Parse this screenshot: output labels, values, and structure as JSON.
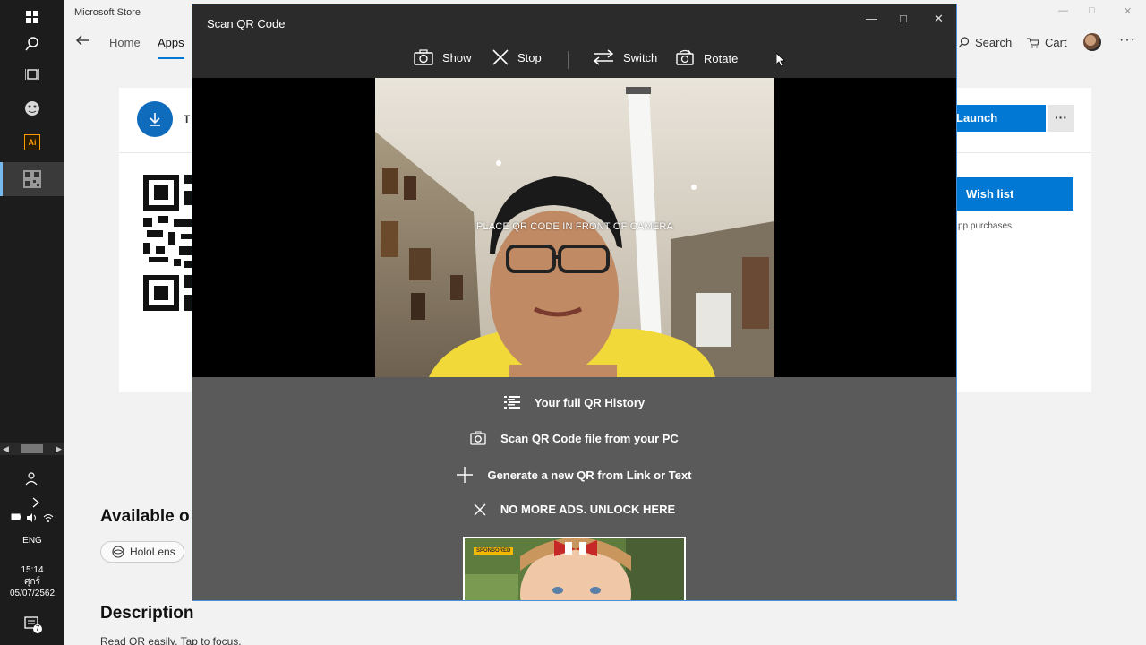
{
  "taskbar": {
    "icons": [
      "windows-start-icon",
      "search-icon",
      "task-view-icon",
      "cortana-icon",
      "illustrator-icon",
      "qr-scanner-icon"
    ],
    "illustrator_label": "Ai",
    "language": "ENG",
    "time": "15:14",
    "day": "ศุกร์",
    "date": "05/07/2562",
    "notification_count": "7"
  },
  "store": {
    "title": "Microsoft Store",
    "nav": {
      "home": "Home",
      "apps": "Apps"
    },
    "search_label": "Search",
    "cart_label": "Cart",
    "app_title_fragment": "T",
    "launch_label": "Launch",
    "more_label": "···",
    "wishlist_label": "Wish list",
    "purchases_fragment": "pp purchases",
    "available_heading": "Available o",
    "device_chip": "HoloLens",
    "description_heading": "Description",
    "description_text": "Read QR easily. Tap to focus."
  },
  "qr_window": {
    "title": "Scan QR Code",
    "toolbar": {
      "show": "Show",
      "stop": "Stop",
      "switch": "Switch",
      "rotate": "Rotate"
    },
    "camera_prompt": "PLACE QR CODE IN FRONT OF CAMERA",
    "menu": {
      "history": "Your full QR History",
      "scan_file": "Scan QR Code file from your PC",
      "generate": "Generate a new QR from Link or Text",
      "no_ads": "NO MORE ADS. UNLOCK HERE"
    },
    "ad_tag": "SPONSORED"
  },
  "colors": {
    "accent": "#0078d4",
    "qr_window_bg": "#2b2b2b",
    "menu_bg": "#5a5a5a",
    "taskbar_bg": "#1c1c1c"
  }
}
